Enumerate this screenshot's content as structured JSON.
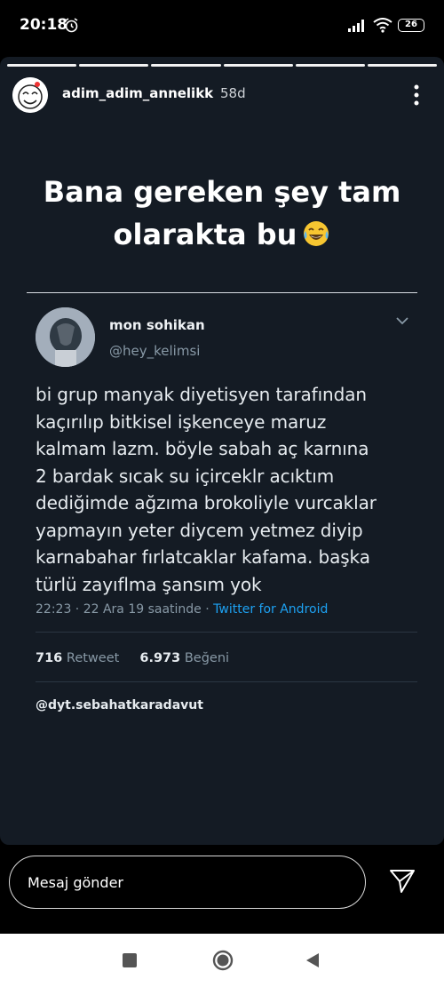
{
  "status": {
    "time": "20:18",
    "battery": "26"
  },
  "story": {
    "username": "adim_adim_annelikk",
    "time_ago": "58d",
    "headline_line1": "Bana gereken şey tam",
    "headline_line2": "olarakta bu",
    "progress_segments": 6
  },
  "tweet": {
    "name": "mon sohikan",
    "handle": "@hey_kelimsi",
    "text": "bi grup manyak diyetisyen tarafından\nkaçırılıp bitkisel işkenceye maruz\nkalmam lazm. böyle sabah aç karnına\n2 bardak sıcak su içirceklr acıktım\ndediğimde ağzıma brokoliyle vurcaklar\nyapmayın yeter diycem yetmez diyip\nkarnabahar fırlatcaklar kafama. başka\ntürlü zayıflma şansım yok",
    "meta_time": "22:23 · 22 Ara 19 saatinde · ",
    "meta_source": "Twitter for Android",
    "retweet_count": "716",
    "retweet_label": "Retweet",
    "like_count": "6.973",
    "like_label": "Beğeni",
    "credit": "@dyt.sebahatkaradavut"
  },
  "reply": {
    "placeholder": "Mesaj gönder"
  },
  "icons": {
    "alarm": "alarm-icon",
    "signal": "signal-icon",
    "wifi": "wifi-icon",
    "more": "more-vertical-icon",
    "chevron": "chevron-down-icon",
    "send": "send-icon",
    "emoji": "laughing-tears-emoji"
  },
  "colors": {
    "story_bg": "#141b24",
    "link": "#1da1f2",
    "muted": "#8899a6"
  }
}
